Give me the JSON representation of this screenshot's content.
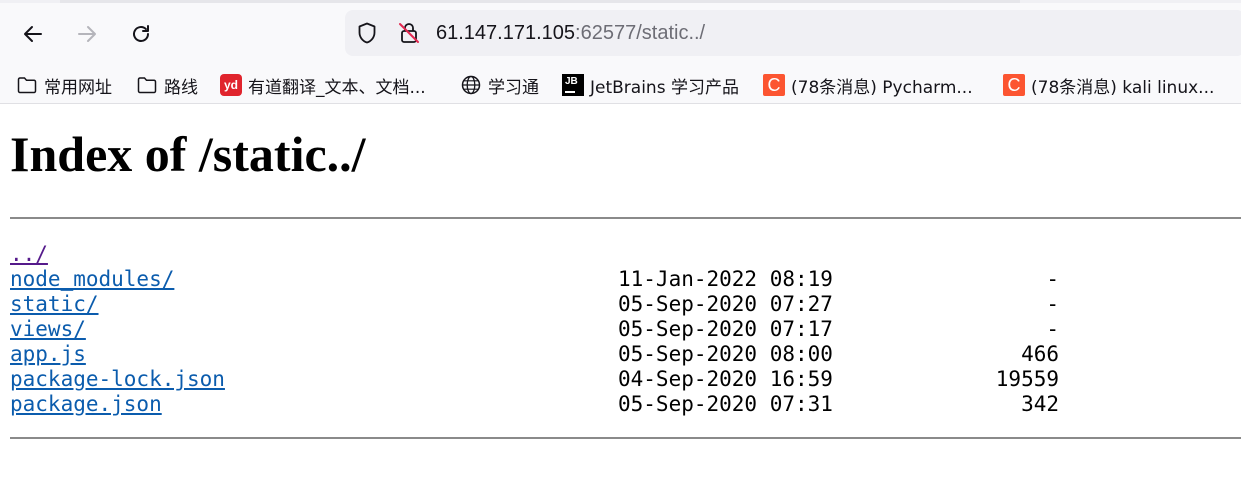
{
  "browser": {
    "address_bar": {
      "host": "61.147.171.105",
      "rest": ":62577/static../"
    },
    "bookmarks": [
      {
        "label": "常用网址",
        "icon": "folder-icon"
      },
      {
        "label": "路线",
        "icon": "folder-icon"
      },
      {
        "label": "有道翻译_文本、文档...",
        "icon": "youdao-icon",
        "icon_text": "yd"
      },
      {
        "label": "学习通",
        "icon": "globe-icon"
      },
      {
        "label": "JetBrains 学习产品",
        "icon": "jetbrains-icon",
        "icon_text": "JB"
      },
      {
        "label": "(78条消息) Pycharm...",
        "icon": "csdn-icon",
        "icon_text": "C"
      },
      {
        "label": "(78条消息) kali linux...",
        "icon": "csdn-icon",
        "icon_text": "C"
      }
    ]
  },
  "page": {
    "title": "Index of /static../",
    "entries": [
      {
        "name": "../",
        "date": "",
        "size": ""
      },
      {
        "name": "node_modules/",
        "date": "11-Jan-2022 08:19",
        "size": "-"
      },
      {
        "name": "static/",
        "date": "05-Sep-2020 07:27",
        "size": "-"
      },
      {
        "name": "views/",
        "date": "05-Sep-2020 07:17",
        "size": "-"
      },
      {
        "name": "app.js",
        "date": "05-Sep-2020 08:00",
        "size": "466"
      },
      {
        "name": "package-lock.json",
        "date": "04-Sep-2020 16:59",
        "size": "19559"
      },
      {
        "name": "package.json",
        "date": "05-Sep-2020 07:31",
        "size": "342"
      }
    ]
  },
  "colors": {
    "link": "#0b5cad",
    "visited_link": "#551a8b",
    "toolbar_bg": "#f9f9fb",
    "urlbar_bg": "#f0f0f4"
  }
}
